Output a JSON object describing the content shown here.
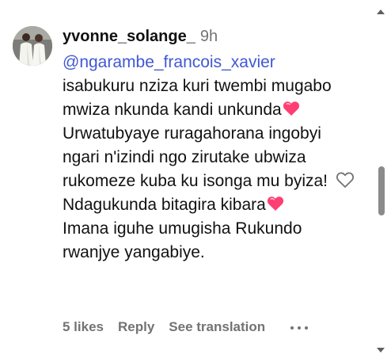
{
  "comment": {
    "username": "yvonne_solange_",
    "timestamp": "9h",
    "mention": "@ngarambe_francois_xavier",
    "text_part1": "isabukuru nziza kuri twembi mugabo mwiza nkunda kandi unkunda",
    "text_part2": " Urwatubyaye ruragahorana ingobyi ngari n'izindi ngo zirutake ubwiza rukomeze kuba ku isonga mu byiza! Ndagukunda bitagira kibara",
    "text_part3": " Imana iguhe umugisha Rukundo rwanjye yangabiye."
  },
  "actions": {
    "likes": "5 likes",
    "reply": "Reply",
    "see_translation": "See translation"
  },
  "icons": {
    "like": "heart-outline-icon",
    "more": "ellipsis-icon",
    "emoji": "red-heart-emoji"
  },
  "colors": {
    "mention": "#4158d4",
    "secondary_text": "#737373",
    "heart_emoji": "#ff3f73"
  }
}
